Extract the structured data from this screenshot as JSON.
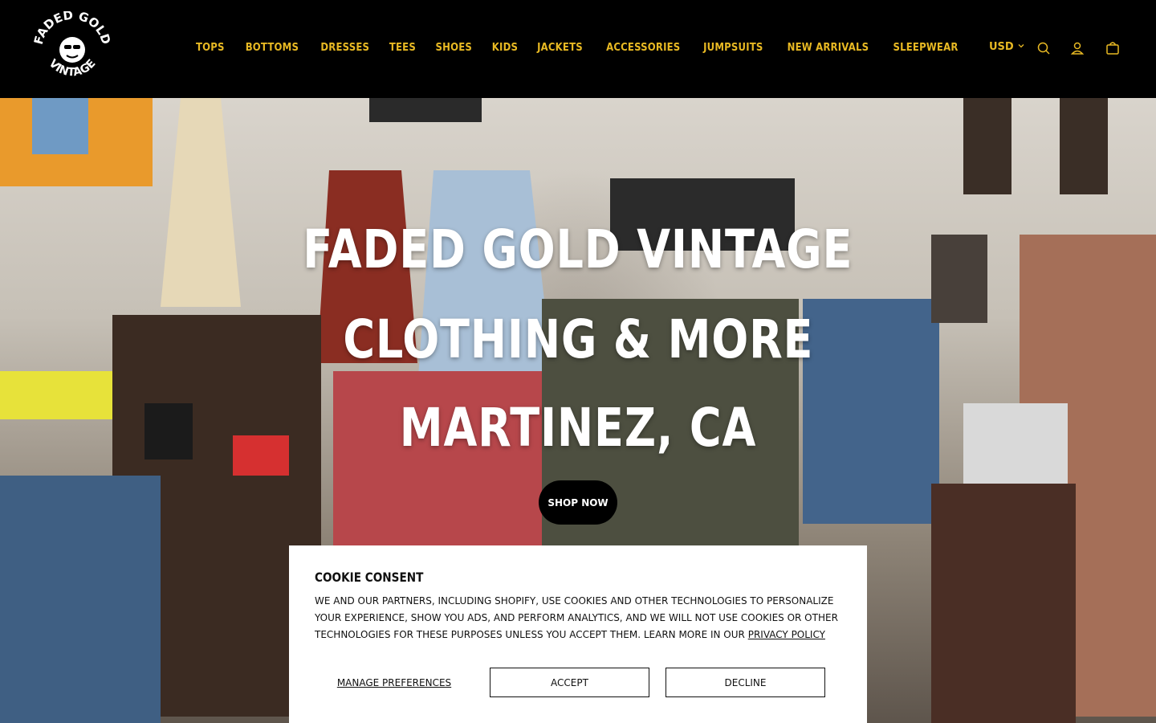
{
  "brand": {
    "logo_line1": "FADED GOLD",
    "logo_line2": "VINTAGE",
    "accent_color": "#e8b923"
  },
  "nav": {
    "items": [
      "TOPS",
      "BOTTOMS",
      "DRESSES",
      "TEES",
      "SHOES",
      "KIDS",
      "JACKETS",
      "ACCESSORIES",
      "JUMPSUITS",
      "NEW ARRIVALS",
      "SLEEPWEAR"
    ]
  },
  "header": {
    "currency": "USD",
    "icons": [
      "chevron-down-icon",
      "search-icon",
      "account-icon",
      "cart-icon"
    ]
  },
  "hero": {
    "line1": "FADED GOLD VINTAGE",
    "line2": "CLOTHING & MORE",
    "line3": "MARTINEZ, CA",
    "cta": "SHOP NOW"
  },
  "cookie": {
    "title": "COOKIE CONSENT",
    "body": "WE AND OUR PARTNERS, INCLUDING SHOPIFY, USE COOKIES AND OTHER TECHNOLOGIES TO PERSONALIZE YOUR EXPERIENCE, SHOW YOU ADS, AND PERFORM ANALYTICS, AND WE WILL NOT USE COOKIES OR OTHER TECHNOLOGIES FOR THESE PURPOSES UNLESS YOU ACCEPT THEM. LEARN MORE IN OUR",
    "policy_link": "PRIVACY POLICY",
    "manage": "MANAGE PREFERENCES",
    "accept": "ACCEPT",
    "decline": "DECLINE"
  }
}
